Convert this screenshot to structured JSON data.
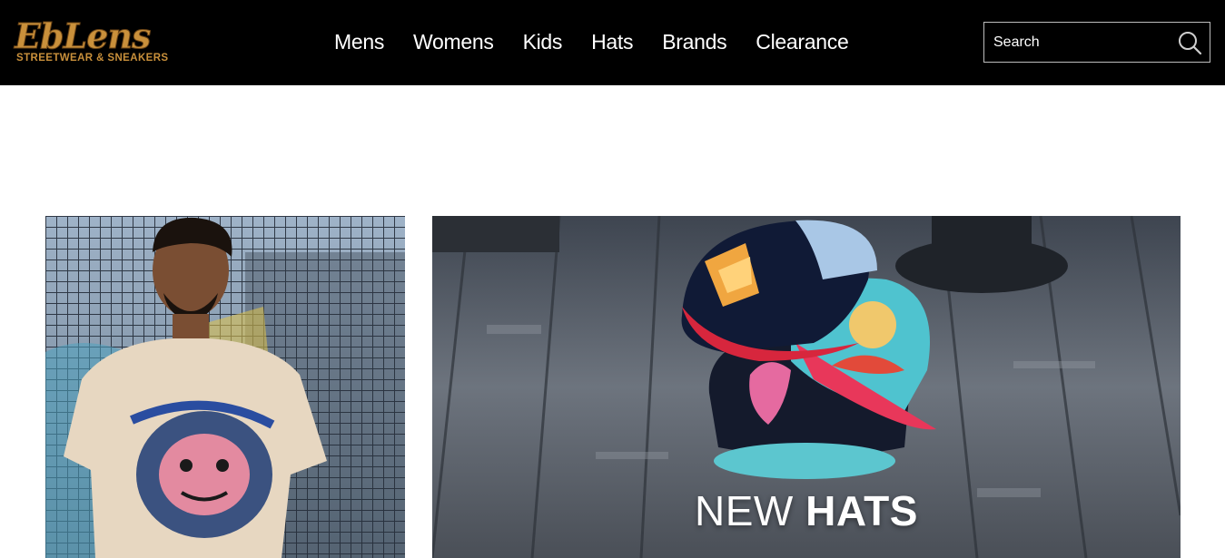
{
  "brand": {
    "logo_main": "EbLens",
    "logo_sub": "STREETWEAR & SNEAKERS",
    "colors": {
      "gold": "#c9903b",
      "header_bg": "#000000"
    }
  },
  "nav": {
    "items": [
      {
        "label": "Mens"
      },
      {
        "label": "Womens"
      },
      {
        "label": "Kids"
      },
      {
        "label": "Hats"
      },
      {
        "label": "Brands"
      },
      {
        "label": "Clearance"
      }
    ]
  },
  "search": {
    "placeholder": "Search",
    "value": "",
    "icon": "search-icon"
  },
  "promos": [
    {
      "name": "mens-tee-promo",
      "caption_light": "",
      "caption_bold": ""
    },
    {
      "name": "new-hats-promo",
      "caption_light": "NEW ",
      "caption_bold": "HATS"
    }
  ]
}
